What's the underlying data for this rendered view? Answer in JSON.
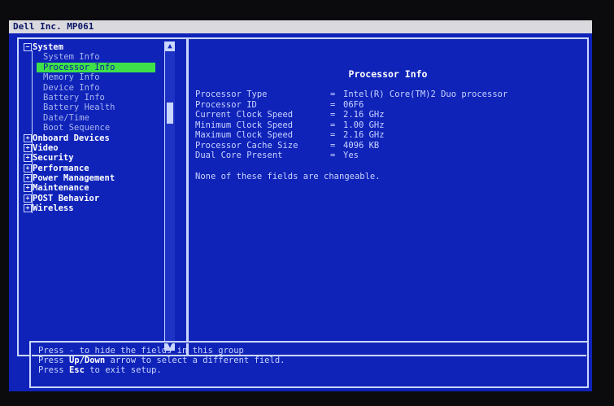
{
  "window": {
    "title": "Dell Inc. MP061"
  },
  "tree": {
    "system": {
      "label": "System",
      "toggle": "−",
      "items": [
        {
          "label": "System Info"
        },
        {
          "label": "Processor Info"
        },
        {
          "label": "Memory Info"
        },
        {
          "label": "Device Info"
        },
        {
          "label": "Battery Info"
        },
        {
          "label": "Battery Health"
        },
        {
          "label": "Date/Time"
        },
        {
          "label": "Boot Sequence"
        }
      ]
    },
    "categories": [
      {
        "label": "Onboard Devices",
        "toggle": "+"
      },
      {
        "label": "Video",
        "toggle": "+"
      },
      {
        "label": "Security",
        "toggle": "+"
      },
      {
        "label": "Performance",
        "toggle": "+"
      },
      {
        "label": "Power Management",
        "toggle": "+"
      },
      {
        "label": "Maintenance",
        "toggle": "+"
      },
      {
        "label": "POST Behavior",
        "toggle": "+"
      },
      {
        "label": "Wireless",
        "toggle": "+"
      }
    ]
  },
  "scrollbar": {
    "up": "▲",
    "down": "▼"
  },
  "details": {
    "title": "Processor Info",
    "separator": "=",
    "fields": [
      {
        "label": "Processor Type",
        "value": "Intel(R) Core(TM)2 Duo processor"
      },
      {
        "label": "Processor ID",
        "value": "06F6"
      },
      {
        "label": "Current Clock Speed",
        "value": "2.16 GHz"
      },
      {
        "label": "Minimum Clock Speed",
        "value": "1.00 GHz"
      },
      {
        "label": "Maximum Clock Speed",
        "value": "2.16 GHz"
      },
      {
        "label": "Processor Cache Size",
        "value": "4096 KB"
      },
      {
        "label": "Dual Core Present",
        "value": "Yes"
      }
    ],
    "note": "None of these fields are changeable."
  },
  "help": {
    "line1": {
      "pre": "Press - to hide the fields in this group"
    },
    "line2": {
      "pre": "Press ",
      "key": "Up/Down",
      "post": " arrow to select a different field."
    },
    "line3": {
      "pre": "Press ",
      "key": "Esc",
      "post": " to exit setup."
    }
  },
  "colors": {
    "background": "#0f23b9",
    "selection": "#3ee04a",
    "titlebar": "#d9d9de"
  }
}
